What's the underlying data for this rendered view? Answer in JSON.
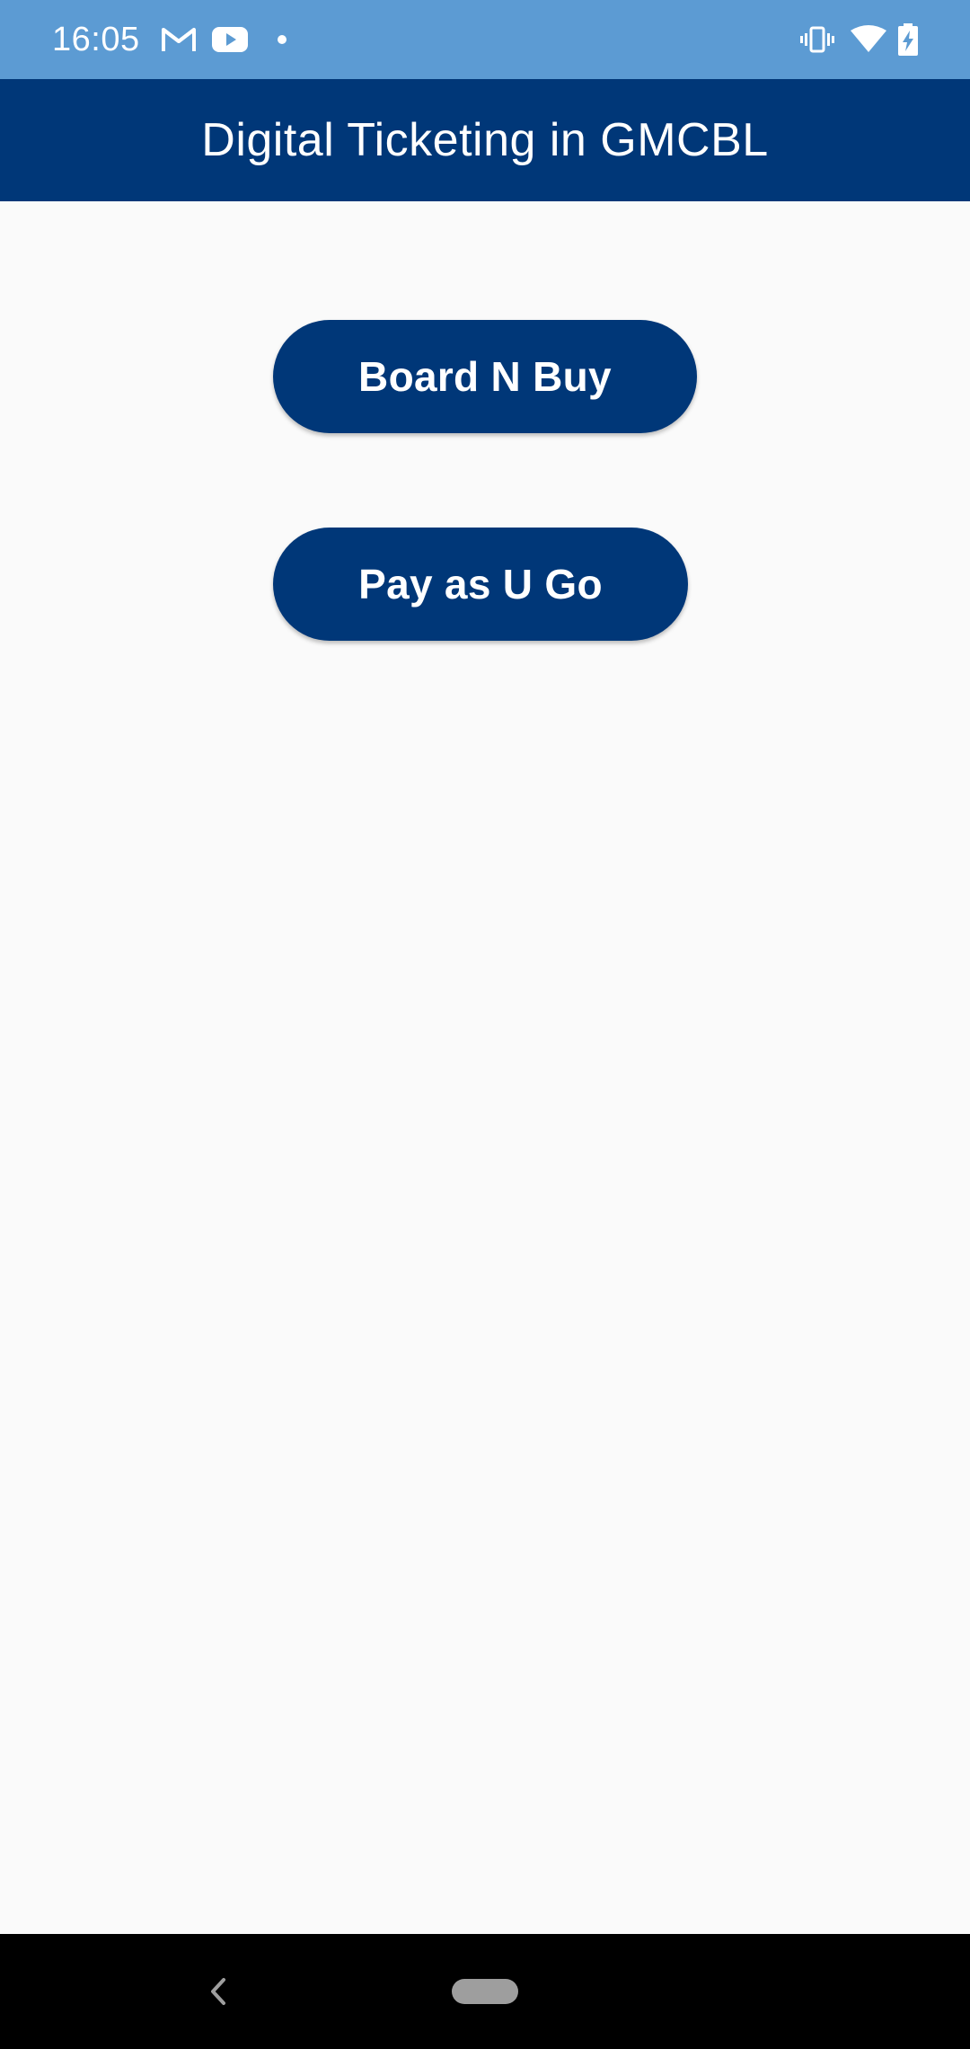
{
  "status_bar": {
    "time": "16:05",
    "left_icons": [
      "gmail-icon",
      "youtube-icon",
      "notification-dot-icon"
    ],
    "right_icons": [
      "vibrate-icon",
      "wifi-icon",
      "battery-charging-icon"
    ]
  },
  "app_bar": {
    "title": "Digital Ticketing in GMCBL"
  },
  "main": {
    "buttons": [
      {
        "label": "Board N Buy"
      },
      {
        "label": "Pay as U Go"
      }
    ]
  },
  "nav_bar": {
    "icons": [
      "back-icon",
      "home-pill-icon"
    ]
  },
  "colors": {
    "status_bar": "#5c9bd3",
    "primary": "#003778",
    "background": "#fafafa",
    "nav_bar": "#000000"
  }
}
